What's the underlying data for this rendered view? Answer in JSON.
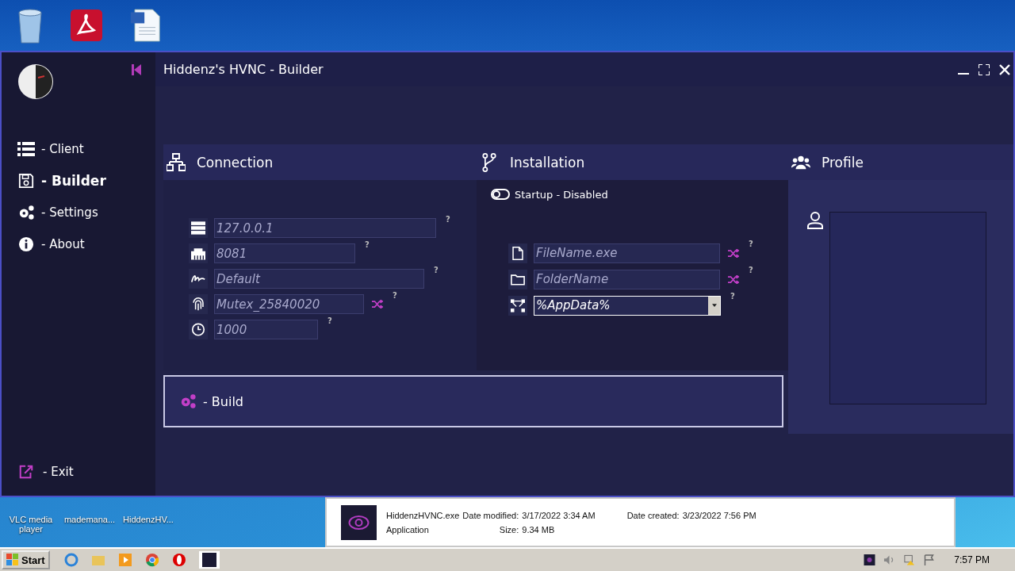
{
  "window": {
    "title": "Hiddenz's HVNC - Builder"
  },
  "sidebar": {
    "items": [
      {
        "label": "- Client",
        "selected": false
      },
      {
        "label": "- Builder",
        "selected": true
      },
      {
        "label": "- Settings",
        "selected": false
      },
      {
        "label": "- About",
        "selected": false
      }
    ],
    "exit": "- Exit"
  },
  "connection": {
    "title": "Connection",
    "fields": [
      {
        "placeholder": "127.0.0.1",
        "help": "?",
        "shuffle": false
      },
      {
        "placeholder": "8081",
        "help": "?",
        "shuffle": false
      },
      {
        "placeholder": "Default",
        "help": "?",
        "shuffle": false
      },
      {
        "placeholder": "Mutex_25840020",
        "help": "?",
        "shuffle": true
      },
      {
        "placeholder": "1000",
        "help": "?",
        "shuffle": false
      }
    ]
  },
  "installation": {
    "title": "Installation",
    "startup": {
      "label": "Startup - Disabled",
      "on": false
    },
    "fields": [
      {
        "kind": "text",
        "placeholder": "FileName.exe",
        "help": "?",
        "shuffle": true
      },
      {
        "kind": "text",
        "placeholder": "FolderName",
        "help": "?",
        "shuffle": true
      },
      {
        "kind": "dropdown",
        "value": "%AppData%",
        "help": "?",
        "shuffle": false
      }
    ]
  },
  "profile": {
    "title": "Profile"
  },
  "build": {
    "label": "- Build"
  },
  "desktop_icons": [
    {
      "label": "VLC media player"
    },
    {
      "label": "mademana..."
    },
    {
      "label": "HiddenzHV..."
    }
  ],
  "details_pane": {
    "name": "HiddenzHVNC.exe",
    "type": "Application",
    "modified_label": "Date modified:",
    "modified": "3/17/2022 3:34 AM",
    "size_label": "Size:",
    "size": "9.34 MB",
    "created_label": "Date created:",
    "created": "3/23/2022 7:56 PM"
  },
  "taskbar": {
    "start": "Start",
    "clock": "7:57 PM"
  }
}
